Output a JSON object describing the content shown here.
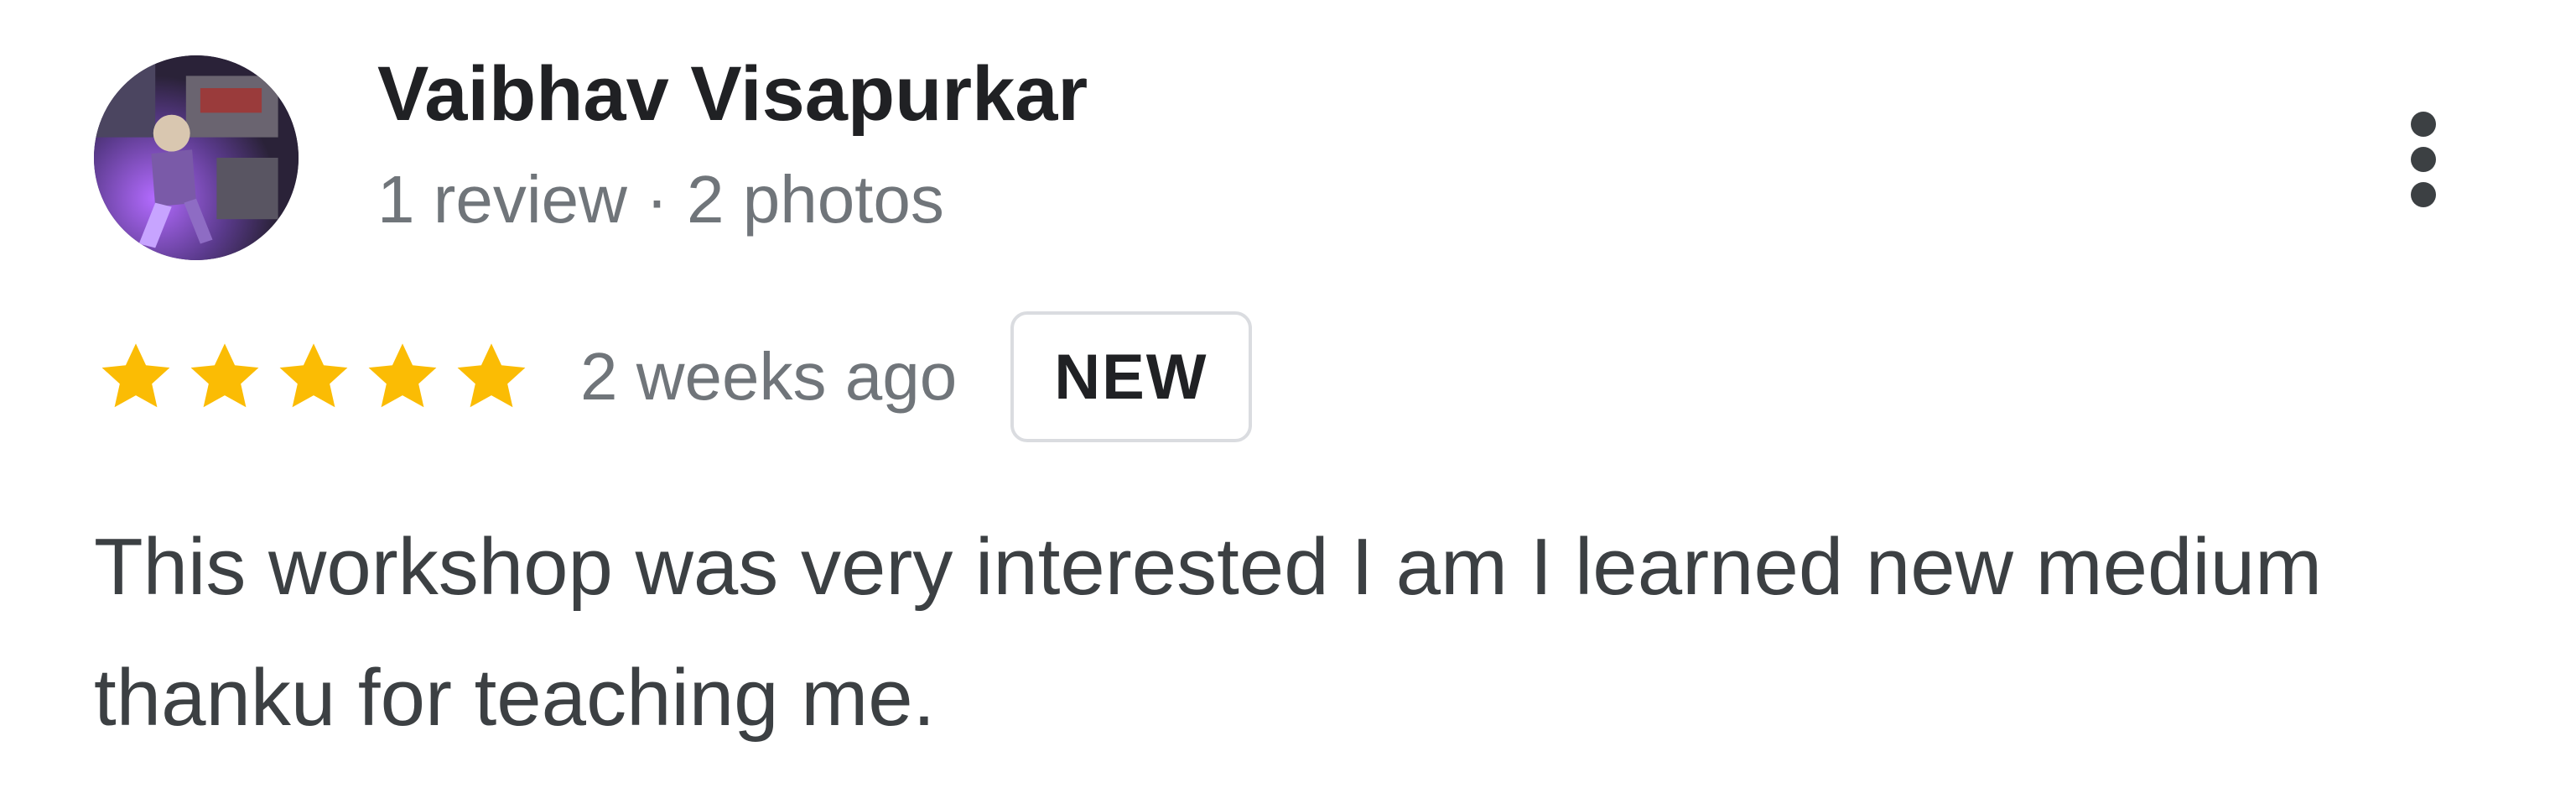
{
  "review": {
    "author_name": "Vaibhav Visapurkar",
    "author_meta": "1 review · 2 photos",
    "rating": 5,
    "max_rating": 5,
    "time": "2 weeks ago",
    "badge": "NEW",
    "text": "This workshop was very interested I am I learned new medium thanku for teaching me."
  },
  "icons": {
    "avatar": "user-avatar-image",
    "star": "star-icon",
    "more": "more-vert-icon"
  },
  "colors": {
    "star": "#fbbc04",
    "name": "#202124",
    "meta": "#70757a",
    "body_text": "#3c4043",
    "badge_border": "#dadce0"
  }
}
